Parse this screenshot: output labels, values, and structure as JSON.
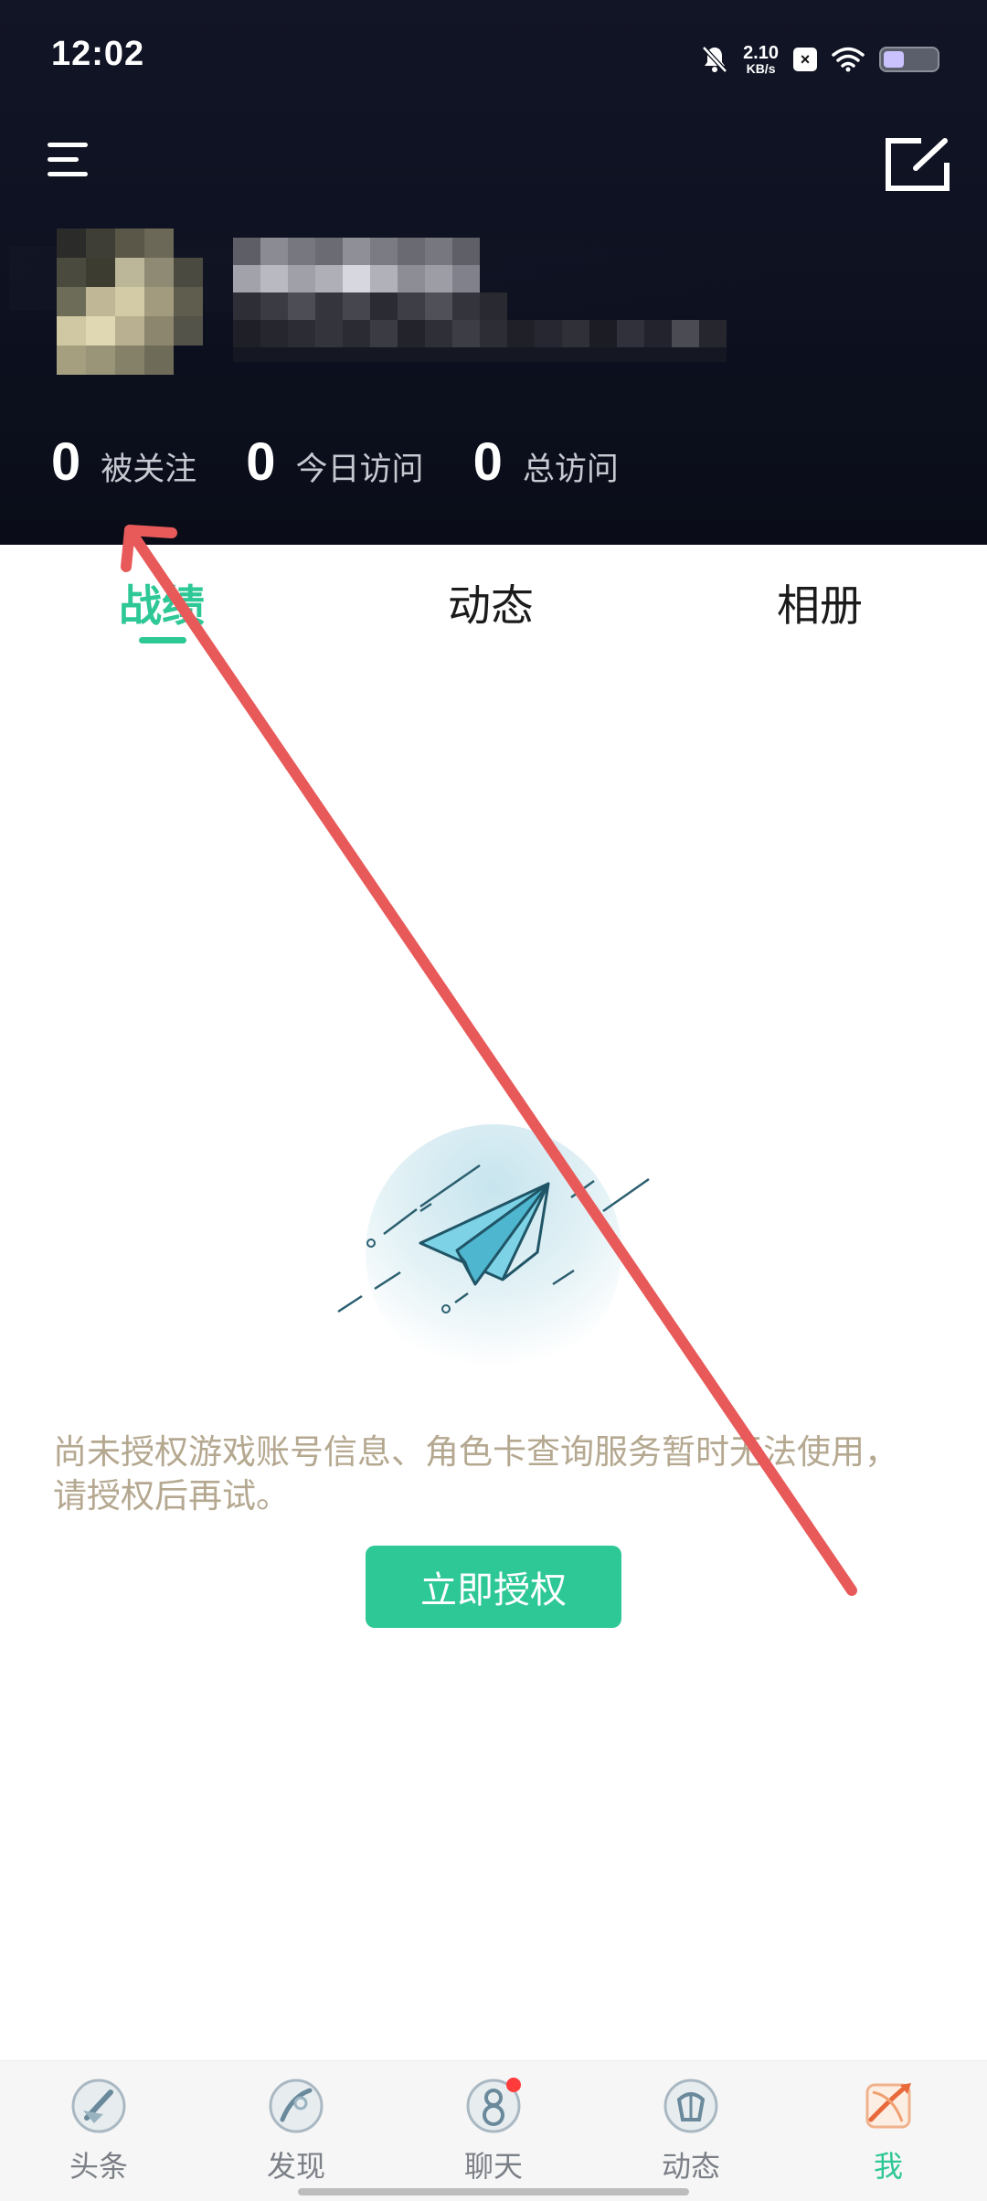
{
  "status_bar": {
    "time": "12:02",
    "net_speed_value": "2.10",
    "net_speed_unit": "KB/s",
    "x_badge": "×",
    "icons": [
      "mute-bell-icon",
      "x-app-icon",
      "wifi-icon",
      "battery-icon"
    ]
  },
  "header": {
    "menu_icon": "menu-icon",
    "edit_icon": "edit-icon",
    "stats": [
      {
        "value": "0",
        "label": "被关注"
      },
      {
        "value": "0",
        "label": "今日访问"
      },
      {
        "value": "0",
        "label": "总访问"
      }
    ]
  },
  "tabs": [
    {
      "label": "战绩",
      "active": true
    },
    {
      "label": "动态",
      "active": false
    },
    {
      "label": "相册",
      "active": false
    }
  ],
  "empty_state": {
    "illustration": "paper-plane-icon",
    "message": "尚未授权游戏账号信息、角色卡查询服务暂时无法使用，请授权后再试。",
    "button_label": "立即授权"
  },
  "bottom_nav": [
    {
      "label": "头条",
      "icon": "headline-icon",
      "active": false
    },
    {
      "label": "发现",
      "icon": "discover-icon",
      "active": false
    },
    {
      "label": "聊天",
      "icon": "chat-icon",
      "active": false,
      "badge": true
    },
    {
      "label": "动态",
      "icon": "feed-icon",
      "active": false
    },
    {
      "label": "我",
      "icon": "me-icon",
      "active": true
    }
  ],
  "colors": {
    "accent": "#2ec896",
    "header_bg": "#0d1120",
    "message_text": "#b5a890",
    "annotation_arrow": "#e85a5a"
  }
}
